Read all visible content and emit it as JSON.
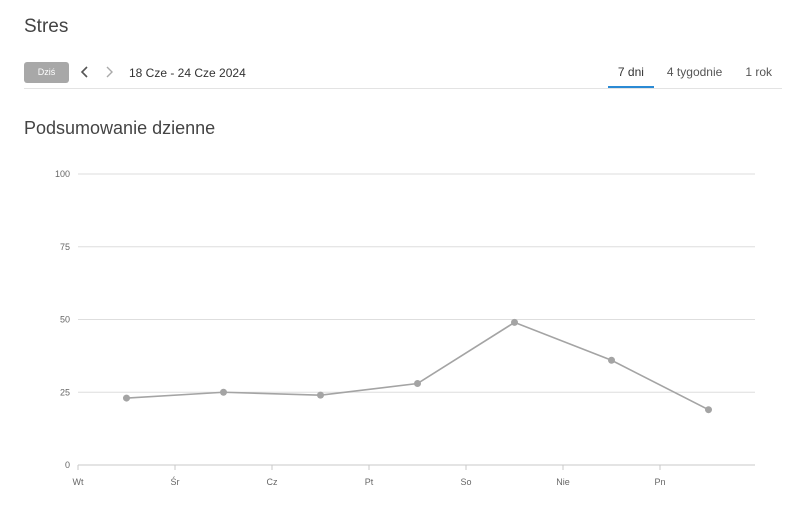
{
  "page": {
    "title": "Stres"
  },
  "toolbar": {
    "today_label": "Dziś",
    "date_range": "18 Cze - 24 Cze 2024",
    "tabs": [
      {
        "label": "7 dni",
        "active": true
      },
      {
        "label": "4 tygodnie",
        "active": false
      },
      {
        "label": "1 rok",
        "active": false
      }
    ],
    "accent_color": "#2a8ad4"
  },
  "summary": {
    "title": "Podsumowanie dzienne"
  },
  "chart_data": {
    "type": "line",
    "categories": [
      "Wt",
      "Śr",
      "Cz",
      "Pt",
      "So",
      "Nie",
      "Pn"
    ],
    "series": [
      {
        "values": [
          23,
          25,
          24,
          28,
          49,
          36,
          19
        ]
      }
    ],
    "yticks": [
      0,
      25,
      50,
      75,
      100
    ],
    "ylim": [
      0,
      100
    ],
    "grid": true,
    "line_color": "#a4a4a4"
  }
}
